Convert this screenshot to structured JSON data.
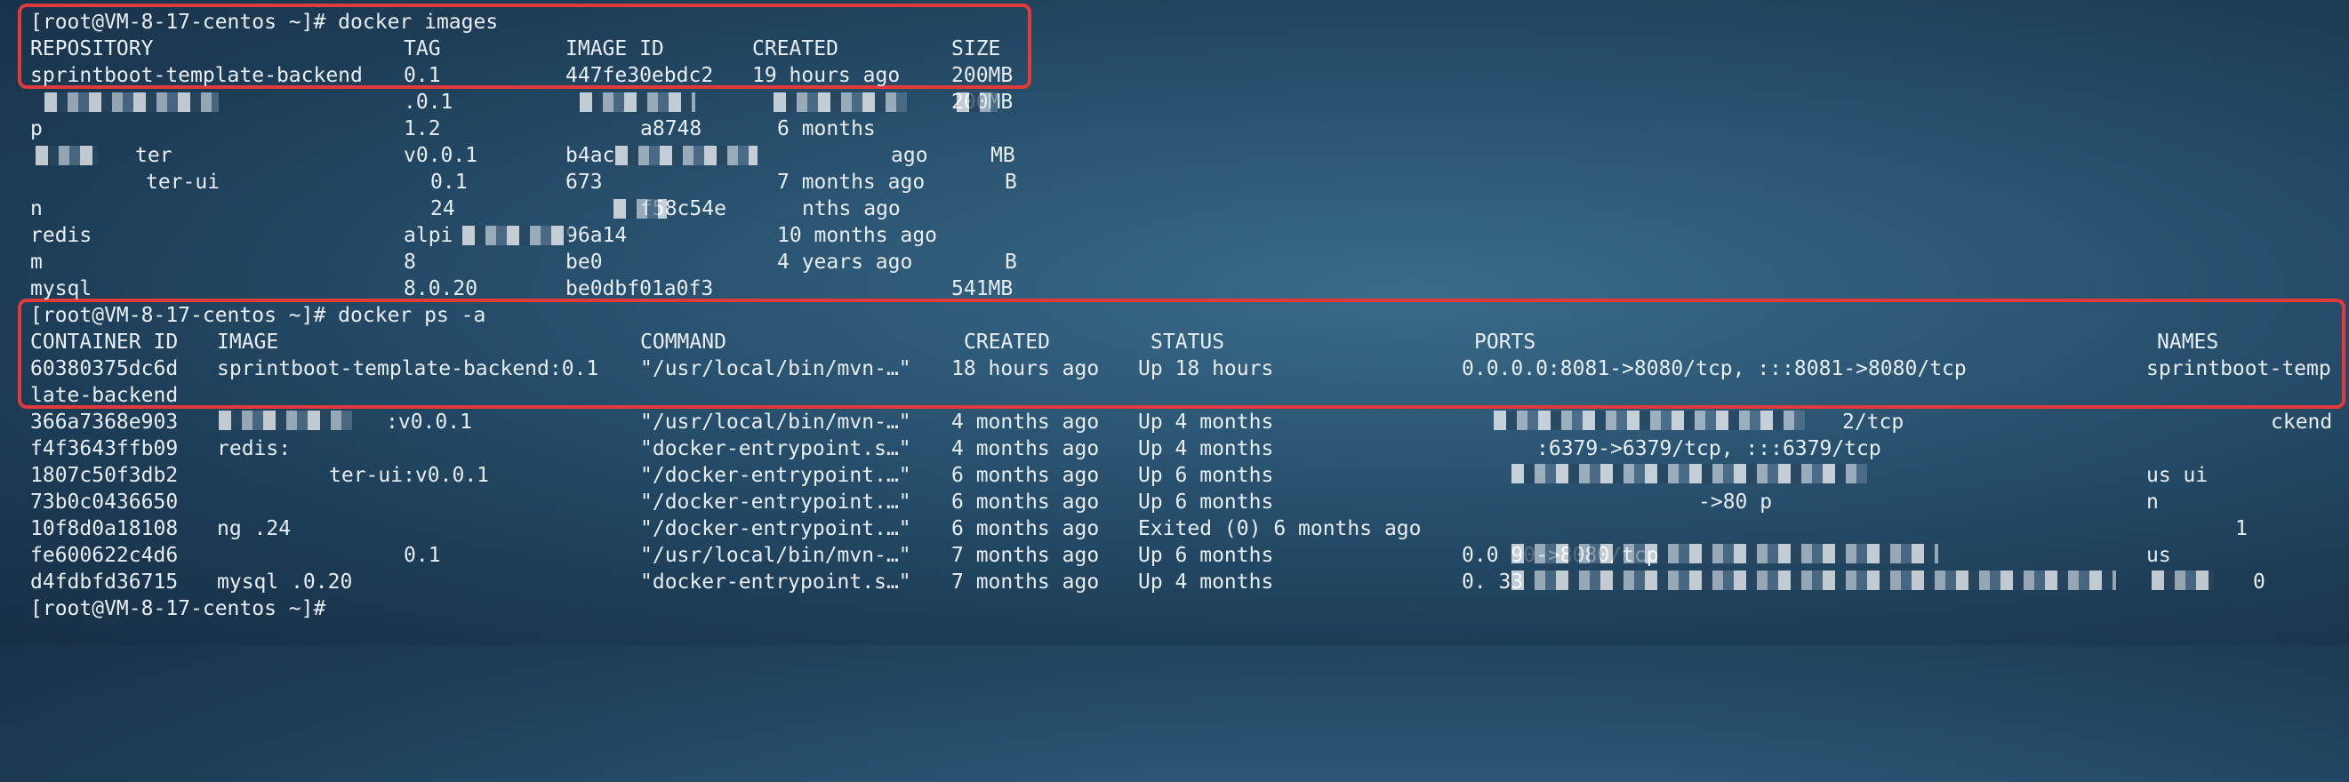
{
  "images_section": {
    "prompt": "[root@VM-8-17-centos ~]# docker images",
    "headers": [
      "REPOSITORY",
      "TAG",
      "IMAGE ID",
      "CREATED",
      "SIZE"
    ],
    "rows": [
      [
        "sprintboot-template-backend",
        "0.1",
        "447fe30ebdc2",
        "19 hours ago",
        "200MB"
      ],
      [
        "",
        ".0.1",
        "",
        "",
        "200MB"
      ],
      [
        "p",
        "1.2",
        "a8748",
        "6 months",
        ""
      ],
      [
        "ter",
        "v0.0.1",
        "b4ac",
        "ago",
        "MB"
      ],
      [
        "ter-ui",
        "0.1",
        "673",
        "7 months ago",
        "B"
      ],
      [
        "n",
        "24",
        "f58c54e",
        "nths ago",
        ""
      ],
      [
        "redis",
        "alpi",
        "96a14",
        "10 months ago",
        ""
      ],
      [
        "m",
        "8",
        "be0",
        "4 years ago",
        "B"
      ],
      [
        "mysql",
        "8.0.20",
        "be0dbf01a0f3",
        "",
        "541MB"
      ]
    ]
  },
  "ps_section": {
    "prompt": "[root@VM-8-17-centos ~]# docker ps -a",
    "headers": [
      "CONTAINER ID",
      "IMAGE",
      "COMMAND",
      "CREATED",
      "STATUS",
      "PORTS",
      "NAMES"
    ],
    "rows": [
      [
        "60380375dc6d",
        "sprintboot-template-backend:0.1",
        "\"/usr/local/bin/mvn-…\"",
        "18 hours ago",
        "Up 18 hours",
        "0.0.0.0:8081->8080/tcp, :::8081->8080/tcp",
        "sprintboot-temp"
      ],
      [
        "late-backend",
        "",
        "",
        "",
        "",
        "",
        ""
      ],
      [
        "366a7368e903",
        ":v0.0.1",
        "\"/usr/local/bin/mvn-…\"",
        "4 months ago",
        "Up 4 months",
        "2/tcp",
        "ckend"
      ],
      [
        "f4f3643ffb09",
        "redis:",
        "\"docker-entrypoint.s…\"",
        "4 months ago",
        "Up 4 months",
        ":6379->6379/tcp, :::6379/tcp",
        ""
      ],
      [
        "1807c50f3db2",
        "ter-ui:v0.0.1",
        "\"/docker-entrypoint.…\"",
        "6 months ago",
        "Up 6 months",
        "",
        "us ui"
      ],
      [
        "73b0c0436650",
        "",
        "\"/docker-entrypoint.…\"",
        "6 months ago",
        "Up 6 months",
        "->80 p",
        "n"
      ],
      [
        "10f8d0a18108",
        "ng .24",
        "\"/docker-entrypoint.…\"",
        "6 months ago",
        "Exited (0) 6 months ago",
        "",
        "1"
      ],
      [
        "fe600622c4d6",
        "0.1",
        "\"/usr/local/bin/mvn-…\"",
        "7 months ago",
        "Up 6 months",
        "0.0 90->8080/tcp",
        "us"
      ],
      [
        "d4fdbfd36715",
        "mysql .0.20",
        "\"docker-entrypoint.s…\"",
        "7 months ago",
        "Up 4 months",
        "0. 33",
        "0"
      ]
    ]
  },
  "final_prompt": "[root@VM-8-17-centos ~]#",
  "colors": {
    "highlight": "#e23a3a",
    "text": "#e8eef2"
  }
}
